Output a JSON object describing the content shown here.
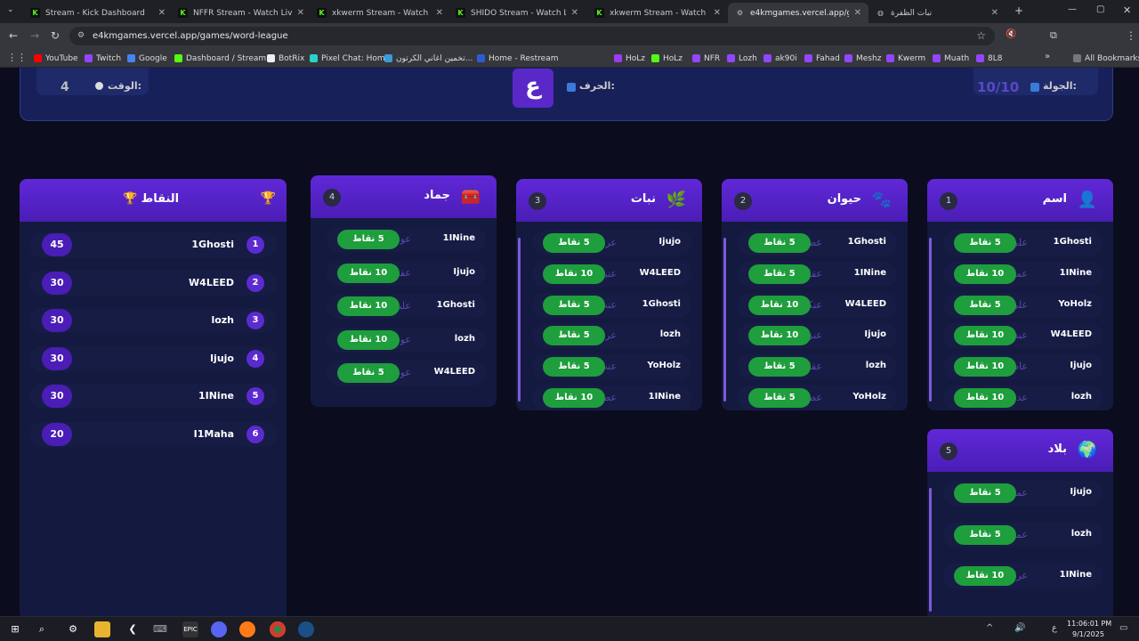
{
  "browser": {
    "tabs": [
      {
        "title": "Stream - Kick Dashboard",
        "icon": "kick-icon"
      },
      {
        "title": "NFFR Stream - Watch Live on K",
        "icon": "kick-icon"
      },
      {
        "title": "xkwerm Stream - Watch Live o",
        "icon": "kick-icon"
      },
      {
        "title": "SHIDO Stream - Watch Live on",
        "icon": "kick-icon"
      },
      {
        "title": "xkwerm Stream - Watch Live o",
        "icon": "kick-icon"
      },
      {
        "title": "e4kmgames.vercel.app/games/",
        "icon": "site-icon",
        "active": true
      },
      {
        "title": "نبات الظفرة",
        "icon": "globe-icon"
      }
    ],
    "url": "e4kmgames.vercel.app/games/word-league",
    "bookmarks": [
      "YouTube",
      "Twitch",
      "Google",
      "Dashboard / Stream...",
      "BotRix",
      "Pixel Chat: Home",
      "تخمين اغاني الكرتون...",
      "Home - Restream",
      "HoLz",
      "HoLz",
      "NFR",
      "Lozh",
      "ak90i",
      "Fahad",
      "Meshz",
      "Kwerm",
      "Muath",
      "8L8"
    ],
    "all_bookmarks": "All Bookmarks"
  },
  "top": {
    "time_label": "الوقت:",
    "time_value": "4",
    "letter_label": "الحرف:",
    "letter_value": "ع",
    "round_label": "الجولة:",
    "round_value": "10/10"
  },
  "leaderboard": {
    "title": "النقاط",
    "rows": [
      {
        "rank": "1",
        "name": "1Ghosti",
        "score": "45"
      },
      {
        "rank": "2",
        "name": "W4LEED",
        "score": "30"
      },
      {
        "rank": "3",
        "name": "lozh",
        "score": "30"
      },
      {
        "rank": "4",
        "name": "Ijujo",
        "score": "30"
      },
      {
        "rank": "5",
        "name": "1INine",
        "score": "30"
      },
      {
        "rank": "6",
        "name": "I1Maha",
        "score": "20"
      }
    ]
  },
  "categories": [
    {
      "num": "1",
      "title": "اسم",
      "icon": "person-icon",
      "rows": [
        {
          "player": "1Ghosti",
          "word": "علي",
          "pts": "5 نقاط"
        },
        {
          "player": "1INine",
          "word": "عمران",
          "pts": "10 نقاط"
        },
        {
          "player": "YoHolz",
          "word": "علي",
          "pts": "5 نقاط"
        },
        {
          "player": "W4LEED",
          "word": "عبدالاله",
          "pts": "10 نقاط"
        },
        {
          "player": "Ijujo",
          "word": "عاصم",
          "pts": "10 نقاط"
        },
        {
          "player": "lozh",
          "word": "عدنان",
          "pts": "10 نقاط"
        }
      ]
    },
    {
      "num": "2",
      "title": "حيوان",
      "icon": "paw-icon",
      "rows": [
        {
          "player": "1Ghosti",
          "word": "عصفور",
          "pts": "5 نقاط"
        },
        {
          "player": "1INine",
          "word": "عقاب",
          "pts": "5 نقاط"
        },
        {
          "player": "W4LEED",
          "word": "عنكبوت",
          "pts": "10 نقاط"
        },
        {
          "player": "Ijujo",
          "word": "عنز",
          "pts": "10 نقاط"
        },
        {
          "player": "lozh",
          "word": "عقاب",
          "pts": "5 نقاط"
        },
        {
          "player": "YoHolz",
          "word": "عصفور",
          "pts": "5 نقاط"
        }
      ]
    },
    {
      "num": "3",
      "title": "نبات",
      "icon": "leaf-icon",
      "rows": [
        {
          "player": "Ijujo",
          "word": "عرعر",
          "pts": "5 نقاط"
        },
        {
          "player": "W4LEED",
          "word": "عنبر",
          "pts": "10 نقاط"
        },
        {
          "player": "1Ghosti",
          "word": "عنب",
          "pts": "5 نقاط"
        },
        {
          "player": "lozh",
          "word": "عرعر",
          "pts": "5 نقاط"
        },
        {
          "player": "YoHolz",
          "word": "عنب",
          "pts": "5 نقاط"
        },
        {
          "player": "1INine",
          "word": "عصفر",
          "pts": "10 نقاط"
        }
      ]
    },
    {
      "num": "4",
      "title": "جماد",
      "icon": "toolbox-icon",
      "rows": [
        {
          "player": "1INine",
          "word": "عود",
          "pts": "5 نقاط"
        },
        {
          "player": "Ijujo",
          "word": "عقد",
          "pts": "10 نقاط"
        },
        {
          "player": "1Ghosti",
          "word": "علبة",
          "pts": "10 نقاط"
        },
        {
          "player": "lozh",
          "word": "عود اسنان",
          "pts": "10 نقاط"
        },
        {
          "player": "W4LEED",
          "word": "عود",
          "pts": "5 نقاط"
        }
      ]
    },
    {
      "num": "5",
      "title": "بلاد",
      "icon": "globe-icon",
      "rows": [
        {
          "player": "Ijujo",
          "word": "عمان",
          "pts": "5 نقاط"
        },
        {
          "player": "lozh",
          "word": "عمان",
          "pts": "5 نقاط"
        },
        {
          "player": "1INine",
          "word": "عراق",
          "pts": "10 نقاط"
        }
      ]
    }
  ],
  "taskbar": {
    "time": "11:06:01 PM",
    "date": "9/1/2025",
    "lang": "ع"
  }
}
